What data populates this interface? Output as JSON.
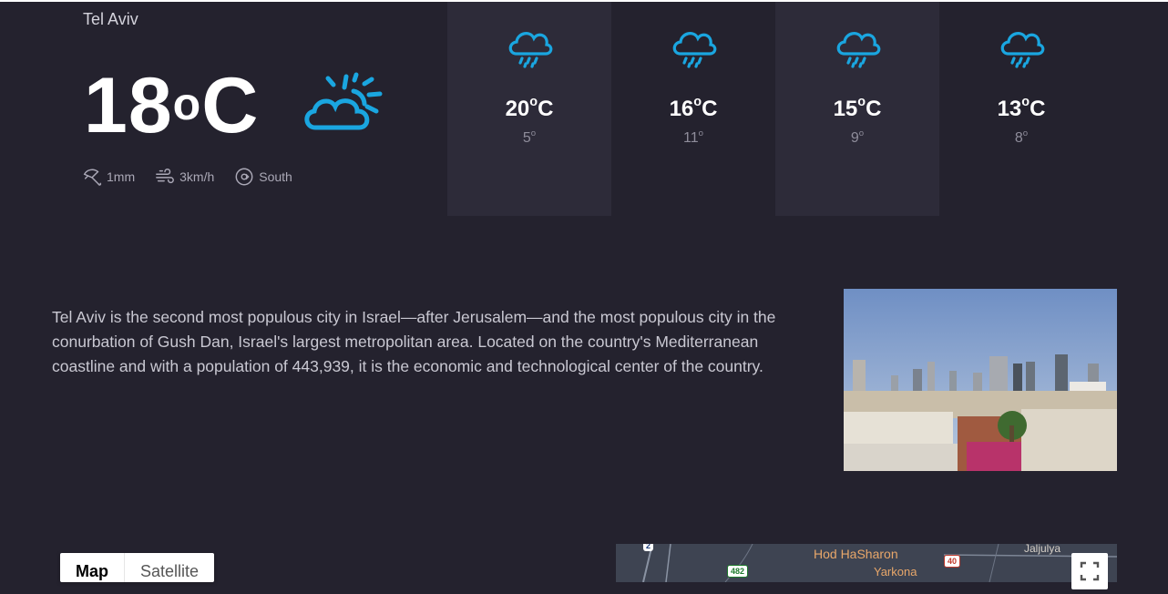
{
  "current": {
    "city": "Tel Aviv",
    "temp_value": "18",
    "temp_unit_sup": "o",
    "temp_unit": "C",
    "icon": "partly-cloudy-sun-icon",
    "metrics": {
      "precipitation": "1mm",
      "wind_speed": "3km/h",
      "wind_direction": "South"
    }
  },
  "forecast": [
    {
      "icon": "rain-cloud-icon",
      "high": "20",
      "low": "5"
    },
    {
      "icon": "rain-cloud-icon",
      "high": "16",
      "low": "11"
    },
    {
      "icon": "rain-cloud-icon",
      "high": "15",
      "low": "9"
    },
    {
      "icon": "rain-cloud-icon",
      "high": "13",
      "low": "8"
    }
  ],
  "degree_mark": "o",
  "unit": "C",
  "description": "Tel Aviv is the second most populous city in Israel—after Jerusalem—and the most populous city in the conurbation of Gush Dan, Israel's largest metropolitan area. Located on the country's Mediterranean coastline and with a population of 443,939, it is the economic and technological center of the country.",
  "map": {
    "tabs": [
      "Map",
      "Satellite"
    ],
    "active_tab": "Map",
    "labels": [
      "Hod HaSharon",
      "Yarkona",
      "Jaljulya"
    ],
    "road_shields": [
      "2",
      "482",
      "40"
    ]
  },
  "colors": {
    "background": "#24222e",
    "card": "#2d2b39",
    "accent": "#1aa6e0"
  }
}
